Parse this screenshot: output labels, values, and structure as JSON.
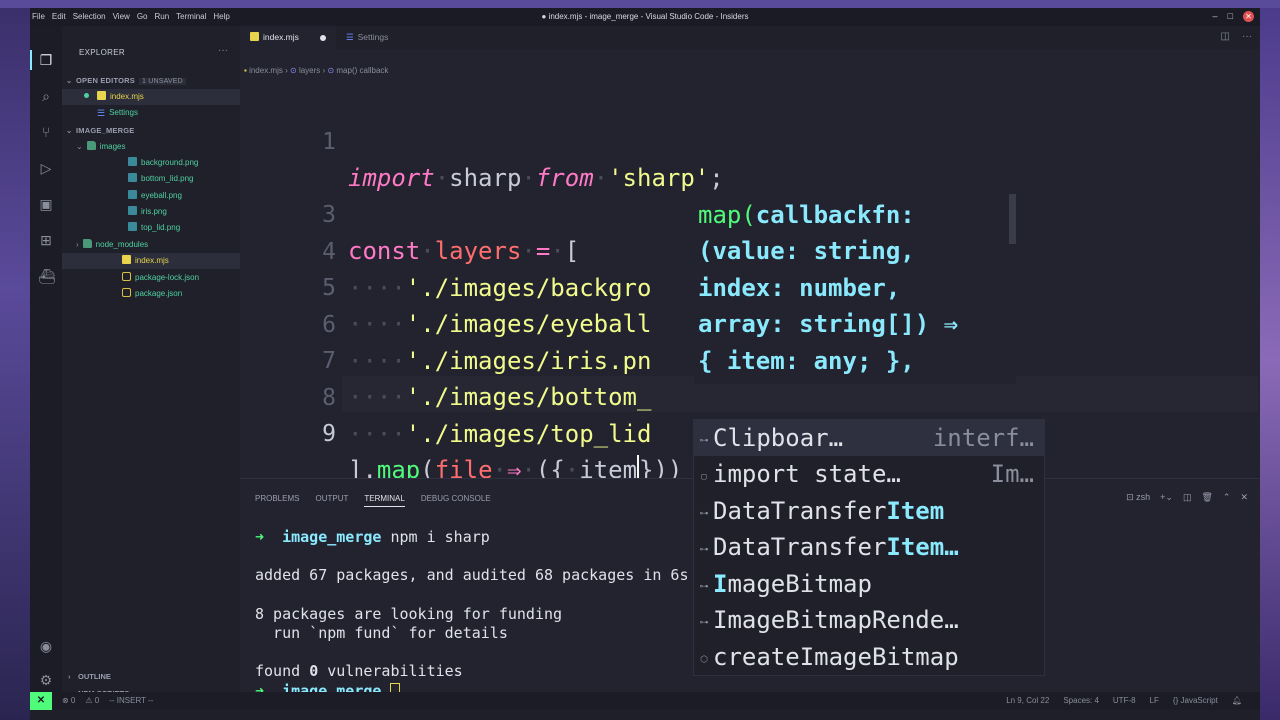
{
  "titlebar": {
    "menu": [
      "File",
      "Edit",
      "Selection",
      "View",
      "Go",
      "Run",
      "Terminal",
      "Help"
    ],
    "title": "● index.mjs - image_merge - Visual Studio Code - Insiders",
    "minimize": "–",
    "maximize": "□",
    "close": "✕"
  },
  "sidebar": {
    "title": "EXPLORER",
    "more": "···",
    "open_editors": {
      "label": "OPEN EDITORS",
      "badge": "1 UNSAVED",
      "items": [
        "index.mjs",
        "Settings"
      ]
    },
    "project": {
      "label": "IMAGE_MERGE",
      "folder_images": "images",
      "image_files": [
        "background.png",
        "bottom_lid.png",
        "eyeball.png",
        "iris.png",
        "top_lid.png"
      ],
      "folder_node_modules": "node_modules",
      "root_files": [
        "index.mjs",
        "package-lock.json",
        "package.json"
      ]
    },
    "outline": "OUTLINE",
    "npm_scripts": "NPM SCRIPTS"
  },
  "tabs": [
    {
      "label": "index.mjs"
    },
    {
      "label": "Settings"
    }
  ],
  "breadcrumb": {
    "file": "index.mjs",
    "sep": "›",
    "symbol1": "layers",
    "symbol2": "map() callback"
  },
  "editor": {
    "line_numbers": [
      "1",
      "3",
      "4",
      "5",
      "6",
      "7",
      "8",
      "9"
    ],
    "line1": {
      "import": "import",
      "name": "sharp",
      "from": "from",
      "module": "'sharp'",
      "semi": ";"
    },
    "line3": {
      "const": "const",
      "name": "layers",
      "eq": "=",
      "bracket": "["
    },
    "line4": "'./images/backgro",
    "line5": "'./images/eyeball",
    "line6": "'./images/iris.pn",
    "line7": "'./images/bottom_",
    "line8": "'./images/top_lid",
    "line9": {
      "start": "].",
      "map": "map",
      "open": "(",
      "param": "file",
      "arrow": "⇒",
      "mid": "({",
      "item": "item",
      "end": "}))"
    }
  },
  "parameter_hint": {
    "fn": "map(",
    "rows": [
      "callbackfn:",
      "(value: string,",
      "index: number,",
      "array: string[]) ⇒",
      "{ item: any; },"
    ]
  },
  "suggestions": [
    {
      "pre": "Clipboar…",
      "bold": "",
      "post": "",
      "detail": "interf…"
    },
    {
      "pre": "import state…",
      "bold": "",
      "post": "",
      "detail": "Im…"
    },
    {
      "pre": "DataTransfer",
      "bold": "Item",
      "post": "",
      "detail": ""
    },
    {
      "pre": "DataTransfer",
      "bold": "Item…",
      "post": "",
      "detail": ""
    },
    {
      "pre": "I",
      "bold": "m",
      "post": "ageBitmap",
      "detail": ""
    },
    {
      "pre": "ImageBitmapRende…",
      "bold": "",
      "post": "",
      "detail": ""
    },
    {
      "pre": "createImageBitmap",
      "bold": "",
      "post": "",
      "detail": ""
    }
  ],
  "panel": {
    "tabs": [
      "PROBLEMS",
      "OUTPUT",
      "TERMINAL",
      "DEBUG CONSOLE"
    ],
    "shell": "zsh",
    "terminal": {
      "prompt": "➜",
      "dir": "image_merge",
      "cmd": "npm i sharp",
      "out1": "added 67 packages, and audited 68 packages in 6s",
      "out2": "8 packages are looking for funding",
      "out3": "  run `npm fund` for details",
      "out4a": "found ",
      "out4b": "0",
      "out4c": " vulnerabilities"
    }
  },
  "statusbar": {
    "remote": "✕",
    "errors": "⊗ 0",
    "warnings": "⚠ 0",
    "mode": "-- INSERT --",
    "position": "Ln 9, Col 22",
    "spaces": "Spaces: 4",
    "encoding": "UTF-8",
    "eol": "LF",
    "language": "{} JavaScript"
  }
}
